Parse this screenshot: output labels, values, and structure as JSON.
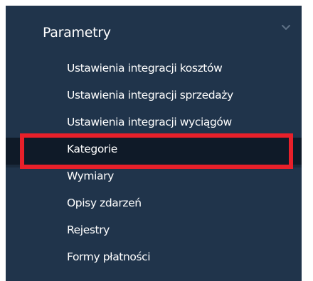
{
  "section": {
    "title": "Parametry",
    "chevron_icon": "chevron-down-icon",
    "expanded": true
  },
  "menu": {
    "items": [
      {
        "label": "Ustawienia integracji kosztów",
        "active": false
      },
      {
        "label": "Ustawienia integracji sprzedaży",
        "active": false
      },
      {
        "label": "Ustawienia integracji wyciągów",
        "active": false
      },
      {
        "label": "Kategorie",
        "active": true
      },
      {
        "label": "Wymiary",
        "active": false
      },
      {
        "label": "Opisy zdarzeń",
        "active": false
      },
      {
        "label": "Rejestry",
        "active": false
      },
      {
        "label": "Formy płatności",
        "active": false
      }
    ]
  },
  "colors": {
    "panel_background": "#20344b",
    "active_item_background": "#0f1a28",
    "text": "#ffffff",
    "chevron": "#5f7186",
    "highlight_outline": "#e8202a"
  }
}
